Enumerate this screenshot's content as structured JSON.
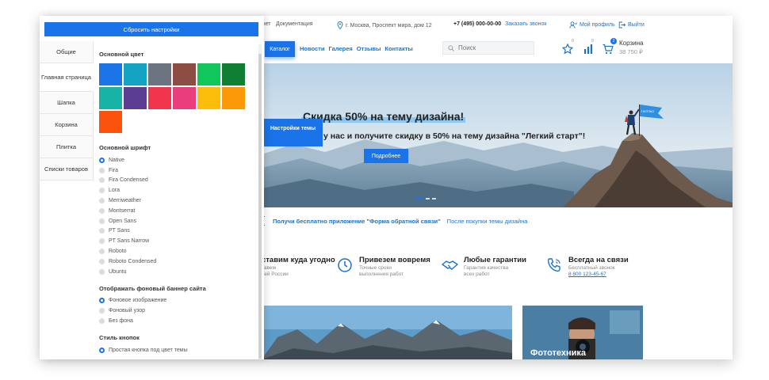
{
  "panel": {
    "reset_label": "Сбросить настройки",
    "tabs": [
      "Общие",
      "Главная страница",
      "Шапка",
      "Корзина",
      "Плитка",
      "Списки товаров"
    ],
    "main_color_title": "Основной цвет",
    "swatches": [
      "#1b74e8",
      "#15a3c4",
      "#6b7480",
      "#8c4e42",
      "#0fc75a",
      "#0e7f33",
      "#17b3a6",
      "#5b3d91",
      "#f0354d",
      "#ea3d7b",
      "#fcbd0b",
      "#fb9909",
      "#fb520d"
    ],
    "font_title": "Основной шрифт",
    "fonts": [
      "Native",
      "Fira",
      "Fira Condensed",
      "Lora",
      "Merriweather",
      "Montserrat",
      "Open Sans",
      "PT Sans",
      "PT Sans Narrow",
      "Roboto",
      "Roboto Condensed",
      "Ubuntu"
    ],
    "banner_title": "Отображать фоновый баннер сайта",
    "banner_options": [
      "Фоновое изображение",
      "Фоновый узор",
      "Без фона"
    ],
    "buttons_title": "Стиль кнопок",
    "button_options": [
      "Простая кнопка под цвет темы"
    ]
  },
  "topbar": {
    "item1": "вет",
    "docs": "Документация",
    "address": "г. Москва, Проспект мира, дом 12",
    "phone": "+7 (495) 000-00-00",
    "callback": "Заказать звонок",
    "profile": "Мой профиль",
    "logout": "Выйти"
  },
  "nav": {
    "catalog": "Каталог",
    "links": [
      "Новости",
      "Галерея",
      "Отзывы",
      "Контакты"
    ],
    "search_placeholder": "Поиск",
    "favorites_count": "0",
    "compare_count": "0",
    "cart_count": "2",
    "cart_label": "Корзина",
    "cart_total": "38 750 ₽"
  },
  "hero": {
    "title": "Скидка 50% на тему дизайна!",
    "subtitle": "у нас и получите скидку в 50% на тему дизайна \"Легкий старт\"!",
    "button": "Подробнее",
    "flag_text": "ГАЛТОКО"
  },
  "theme_button": "Настройки темы",
  "promo": {
    "bold": "Получи бесплатно приложение \"Форма обратной связи\"",
    "plain": "После покупки темы дизайна"
  },
  "features": [
    {
      "title": "ставим куда угодно",
      "line1": "тавем",
      "line2": "сей России"
    },
    {
      "title": "Привезем вовремя",
      "line1": "Точные сроки",
      "line2": "выполнения работ"
    },
    {
      "title": "Любые гарантии",
      "line1": "Гарантия качества",
      "line2": "всех работ"
    },
    {
      "title": "Всегда на связи",
      "line1": "Бесплатный звонок",
      "line2": "8 800 123-45-67"
    }
  ],
  "cards": {
    "right_caption": "Фототехника"
  }
}
